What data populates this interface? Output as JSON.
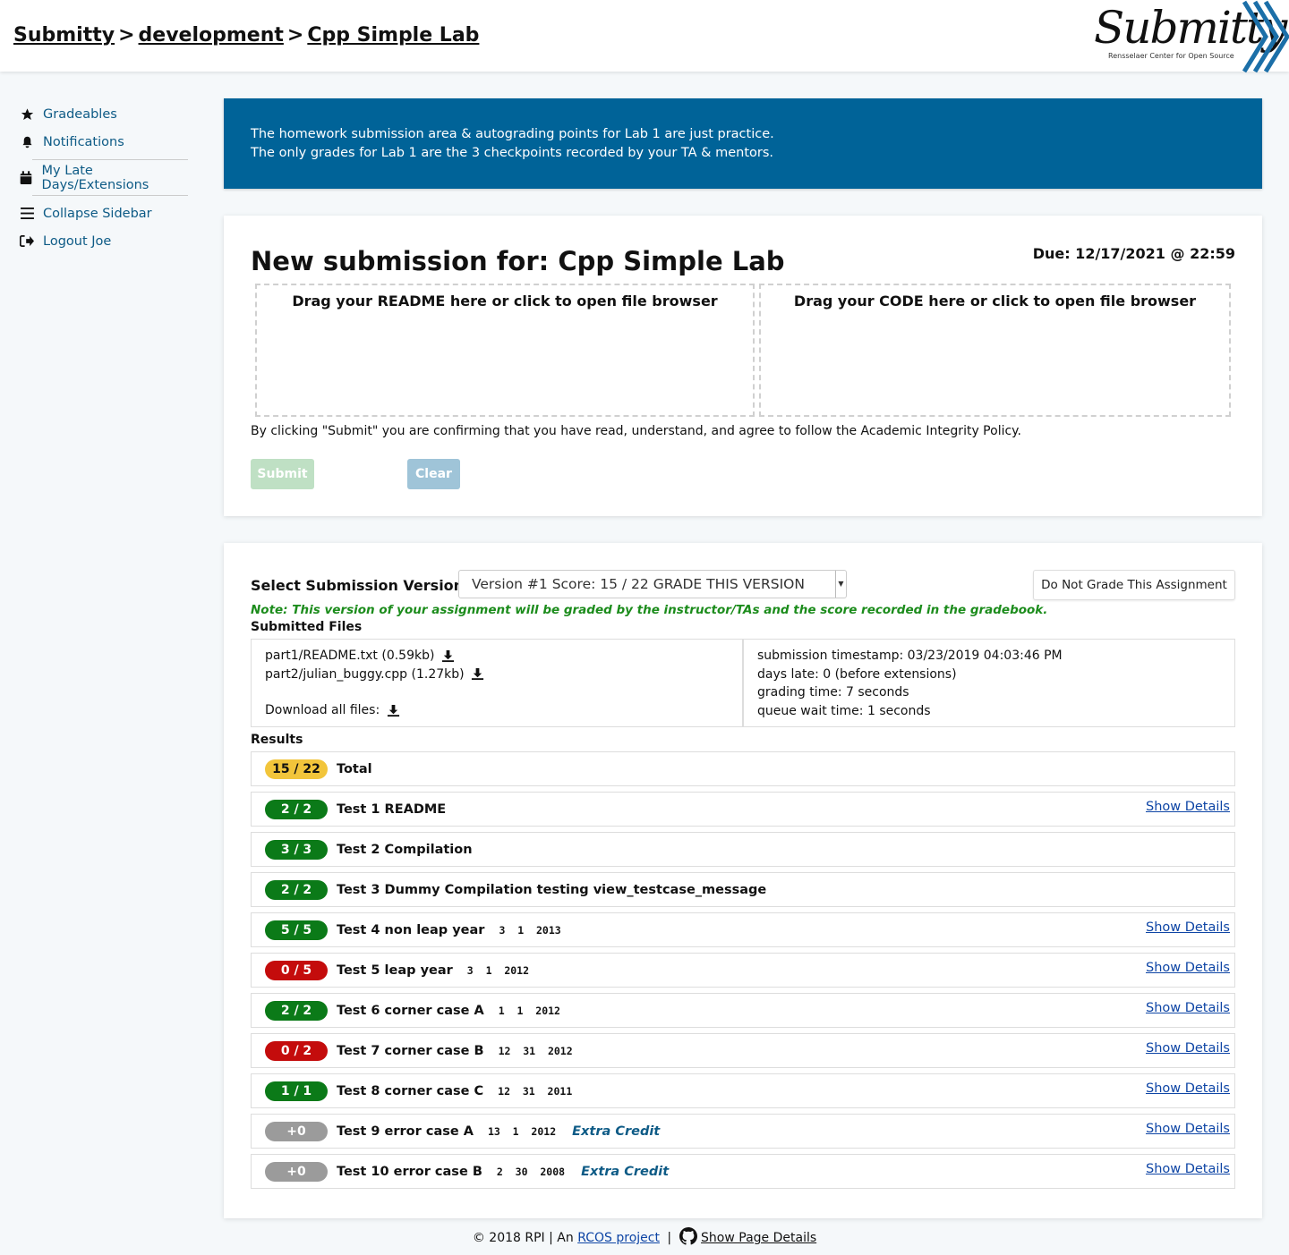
{
  "header": {
    "breadcrumb": [
      "Submitty",
      "development",
      "Cpp Simple Lab"
    ],
    "separator": ">",
    "logo_text": "Submitty",
    "logo_subtext": "Rensselaer Center for Open Source"
  },
  "sidebar": {
    "items": [
      {
        "label": "Gradeables",
        "icon": "star-icon"
      },
      {
        "label": "Notifications",
        "icon": "bell-icon"
      },
      {
        "label": "My Late Days/Extensions",
        "icon": "calendar-icon"
      },
      {
        "label": "Collapse Sidebar",
        "icon": "bars-icon"
      },
      {
        "label": "Logout Joe",
        "icon": "logout-icon"
      }
    ]
  },
  "banner": {
    "line1": "The homework submission area & autograding points for Lab 1 are just practice.",
    "line2": "The only grades for Lab 1 are the 3 checkpoints recorded by your TA & mentors."
  },
  "submission": {
    "title": "New submission for: Cpp Simple Lab",
    "due": "Due: 12/17/2021 @ 22:59",
    "dropzone_readme": "Drag your README here or click to open file browser",
    "dropzone_code": "Drag your CODE here or click to open file browser",
    "integrity_text": "By clicking \"Submit\" you are confirming that you have read, understand, and agree to follow the Academic Integrity Policy.",
    "submit_label": "Submit",
    "clear_label": "Clear"
  },
  "version": {
    "label": "Select Submission Version:",
    "selected": "Version #1   Score: 15 / 22   GRADE THIS VERSION",
    "no_grade_label": "Do Not Grade This Assignment",
    "note": "Note: This version of your assignment will be graded by the instructor/TAs and the score recorded in the gradebook."
  },
  "files": {
    "label": "Submitted Files",
    "file1": "part1/README.txt (0.59kb)",
    "file2": "part2/julian_buggy.cpp (1.27kb)",
    "download_all": "Download all files:",
    "timestamp": "submission timestamp: 03/23/2019 04:03:46 PM",
    "days_late": "days late: 0 (before extensions)",
    "grading_time": "grading time: 7 seconds",
    "queue_wait": "queue wait time: 1 seconds"
  },
  "results": {
    "label": "Results",
    "show_details": "Show Details",
    "extra_credit": "Extra Credit",
    "rows": [
      {
        "score": "15 / 22",
        "title": "Total",
        "args": "",
        "color": "yellow",
        "details": false,
        "extra": false
      },
      {
        "score": "2 / 2",
        "title": "Test 1 README",
        "args": "",
        "color": "green",
        "details": true,
        "extra": false
      },
      {
        "score": "3 / 3",
        "title": "Test 2 Compilation",
        "args": "",
        "color": "green",
        "details": false,
        "extra": false
      },
      {
        "score": "2 / 2",
        "title": "Test 3 Dummy Compilation testing view_testcase_message",
        "args": "",
        "color": "green",
        "details": false,
        "extra": false
      },
      {
        "score": "5 / 5",
        "title": "Test 4 non leap year",
        "args": "3  1  2013",
        "color": "green",
        "details": true,
        "extra": false
      },
      {
        "score": "0 / 5",
        "title": "Test 5 leap year",
        "args": "3  1  2012",
        "color": "red",
        "details": true,
        "extra": false
      },
      {
        "score": "2 / 2",
        "title": "Test 6 corner case A",
        "args": "1  1  2012",
        "color": "green",
        "details": true,
        "extra": false
      },
      {
        "score": "0 / 2",
        "title": "Test 7 corner case B",
        "args": "12  31  2012",
        "color": "red",
        "details": true,
        "extra": false
      },
      {
        "score": "1 / 1",
        "title": "Test 8 corner case C",
        "args": "12  31  2011",
        "color": "green",
        "details": true,
        "extra": false
      },
      {
        "score": "+0",
        "title": "Test 9 error case A",
        "args": "13  1  2012",
        "color": "gray",
        "details": true,
        "extra": true
      },
      {
        "score": "+0",
        "title": "Test 10 error case B",
        "args": "2  30  2008",
        "color": "gray",
        "details": true,
        "extra": true
      }
    ]
  },
  "footer": {
    "copyright": "© 2018 RPI | An",
    "rcos_link": "RCOS project",
    "pipe": "|",
    "page_details": "Show Page Details"
  }
}
